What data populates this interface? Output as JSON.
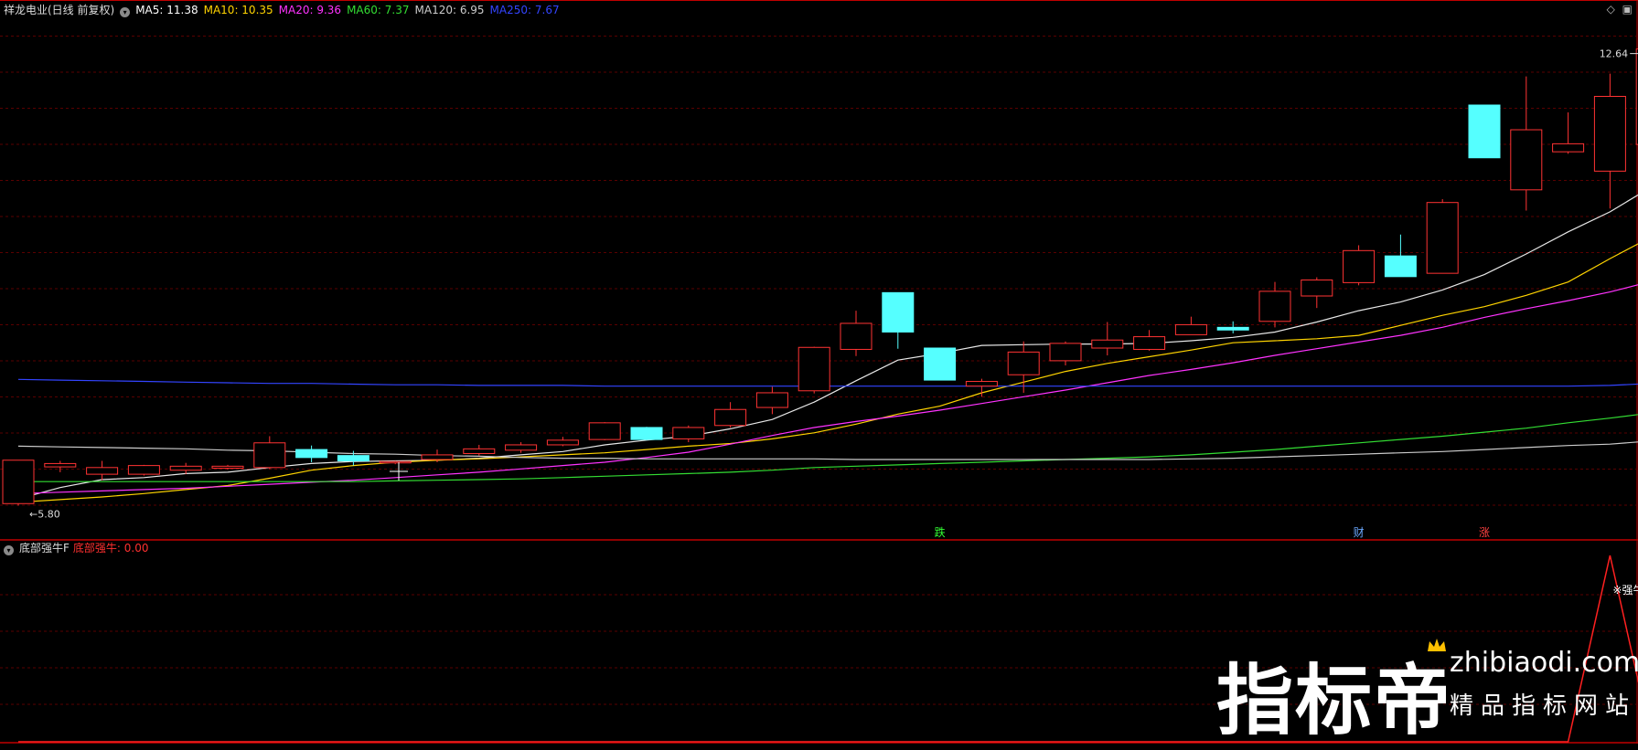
{
  "header": {
    "stock_title": "祥龙电业(日线 前复权)",
    "ma": [
      {
        "label": "MA5: 11.38",
        "color": "#ffffff"
      },
      {
        "label": "MA10: 10.35",
        "color": "#ffd400"
      },
      {
        "label": "MA20: 9.36",
        "color": "#ff33ff"
      },
      {
        "label": "MA60: 7.37",
        "color": "#33dd33"
      },
      {
        "label": "MA120: 6.95",
        "color": "#cccccc"
      },
      {
        "label": "MA250: 7.67",
        "color": "#3344ff"
      }
    ],
    "right_icons": [
      "diamond-icon",
      "square-icon"
    ]
  },
  "lower_header": {
    "indicator_name": "底部强牛F",
    "value_label": "底部强牛: 0.00",
    "value_color": "#ff3030"
  },
  "chart_data": {
    "type": "candlestick",
    "price_range": [
      5.3,
      13.1
    ],
    "max_label": "12.64",
    "min_label": "5.80",
    "up_color": "#ff3333",
    "down_color": "#55ffff",
    "candles": [
      {
        "o": 5.83,
        "h": 6.48,
        "l": 5.8,
        "c": 6.48
      },
      {
        "o": 6.38,
        "h": 6.47,
        "l": 6.3,
        "c": 6.43
      },
      {
        "o": 6.27,
        "h": 6.47,
        "l": 6.18,
        "c": 6.37
      },
      {
        "o": 6.27,
        "h": 6.41,
        "l": 6.25,
        "c": 6.4
      },
      {
        "o": 6.33,
        "h": 6.44,
        "l": 6.27,
        "c": 6.39
      },
      {
        "o": 6.36,
        "h": 6.41,
        "l": 6.34,
        "c": 6.39
      },
      {
        "o": 6.37,
        "h": 6.84,
        "l": 6.35,
        "c": 6.74
      },
      {
        "o": 6.64,
        "h": 6.7,
        "l": 6.45,
        "c": 6.52
      },
      {
        "o": 6.55,
        "h": 6.62,
        "l": 6.4,
        "c": 6.47
      },
      {
        "o": 6.46,
        "h": 6.47,
        "l": 6.42,
        "c": 6.46
      },
      {
        "o": 6.49,
        "h": 6.64,
        "l": 6.45,
        "c": 6.56
      },
      {
        "o": 6.58,
        "h": 6.71,
        "l": 6.55,
        "c": 6.65
      },
      {
        "o": 6.63,
        "h": 6.75,
        "l": 6.59,
        "c": 6.71
      },
      {
        "o": 6.71,
        "h": 6.83,
        "l": 6.69,
        "c": 6.78
      },
      {
        "o": 6.79,
        "h": 7.05,
        "l": 6.78,
        "c": 7.04
      },
      {
        "o": 6.97,
        "h": 6.98,
        "l": 6.78,
        "c": 6.79
      },
      {
        "o": 6.8,
        "h": 7.0,
        "l": 6.75,
        "c": 6.97
      },
      {
        "o": 7.0,
        "h": 7.35,
        "l": 6.97,
        "c": 7.24
      },
      {
        "o": 7.27,
        "h": 7.58,
        "l": 7.17,
        "c": 7.49
      },
      {
        "o": 7.52,
        "h": 8.18,
        "l": 7.48,
        "c": 8.17
      },
      {
        "o": 8.14,
        "h": 8.72,
        "l": 8.04,
        "c": 8.53
      },
      {
        "o": 8.99,
        "h": 8.99,
        "l": 8.15,
        "c": 8.4
      },
      {
        "o": 8.16,
        "h": 8.16,
        "l": 7.68,
        "c": 7.68
      },
      {
        "o": 7.59,
        "h": 7.7,
        "l": 7.43,
        "c": 7.66
      },
      {
        "o": 7.76,
        "h": 8.26,
        "l": 7.49,
        "c": 8.1
      },
      {
        "o": 7.97,
        "h": 8.26,
        "l": 7.9,
        "c": 8.23
      },
      {
        "o": 8.16,
        "h": 8.55,
        "l": 8.05,
        "c": 8.28
      },
      {
        "o": 8.14,
        "h": 8.43,
        "l": 8.12,
        "c": 8.33
      },
      {
        "o": 8.36,
        "h": 8.63,
        "l": 8.36,
        "c": 8.51
      },
      {
        "o": 8.47,
        "h": 8.56,
        "l": 8.38,
        "c": 8.43
      },
      {
        "o": 8.56,
        "h": 9.15,
        "l": 8.47,
        "c": 9.01
      },
      {
        "o": 8.94,
        "h": 9.22,
        "l": 8.76,
        "c": 9.18
      },
      {
        "o": 9.14,
        "h": 9.7,
        "l": 9.1,
        "c": 9.62
      },
      {
        "o": 9.54,
        "h": 9.86,
        "l": 9.23,
        "c": 9.23
      },
      {
        "o": 9.28,
        "h": 10.39,
        "l": 9.28,
        "c": 10.34
      },
      {
        "o": 11.8,
        "h": 11.8,
        "l": 11.01,
        "c": 11.01
      },
      {
        "o": 10.53,
        "h": 12.23,
        "l": 10.22,
        "c": 11.43
      },
      {
        "o": 11.1,
        "h": 11.69,
        "l": 11.07,
        "c": 11.22
      },
      {
        "o": 10.81,
        "h": 12.27,
        "l": 10.25,
        "c": 11.93
      },
      {
        "o": 11.21,
        "h": 12.64,
        "l": 11.21,
        "c": 12.64
      }
    ],
    "ma_lines": [
      {
        "name": "MA5",
        "color": "#e8e8e8",
        "values": [
          5.9,
          6.07,
          6.19,
          6.22,
          6.28,
          6.3,
          6.37,
          6.43,
          6.46,
          6.47,
          6.48,
          6.51,
          6.56,
          6.61,
          6.71,
          6.78,
          6.84,
          6.95,
          7.09,
          7.35,
          7.67,
          7.98,
          8.08,
          8.2,
          8.21,
          8.22,
          8.22,
          8.23,
          8.27,
          8.32,
          8.4,
          8.55,
          8.72,
          8.85,
          9.03,
          9.26,
          9.57,
          9.9,
          10.2,
          10.58
        ]
      },
      {
        "name": "MA10",
        "color": "#ffd400",
        "values": [
          5.85,
          5.89,
          5.93,
          5.98,
          6.04,
          6.1,
          6.21,
          6.33,
          6.4,
          6.45,
          6.48,
          6.5,
          6.53,
          6.56,
          6.59,
          6.64,
          6.69,
          6.73,
          6.8,
          6.89,
          7.02,
          7.17,
          7.29,
          7.49,
          7.65,
          7.81,
          7.93,
          8.03,
          8.13,
          8.24,
          8.27,
          8.3,
          8.35,
          8.5,
          8.65,
          8.78,
          8.95,
          9.15,
          9.5,
          9.83
        ]
      },
      {
        "name": "MA20",
        "color": "#ff33ff",
        "values": [
          5.98,
          6.0,
          6.02,
          6.04,
          6.06,
          6.09,
          6.12,
          6.15,
          6.18,
          6.22,
          6.26,
          6.3,
          6.35,
          6.4,
          6.45,
          6.52,
          6.6,
          6.72,
          6.85,
          6.97,
          7.06,
          7.14,
          7.23,
          7.33,
          7.43,
          7.53,
          7.64,
          7.75,
          7.84,
          7.94,
          8.05,
          8.15,
          8.25,
          8.35,
          8.47,
          8.62,
          8.75,
          8.87,
          9.0,
          9.16
        ]
      },
      {
        "name": "MA60",
        "color": "#33dd33",
        "values": [
          6.16,
          6.16,
          6.16,
          6.16,
          6.16,
          6.16,
          6.16,
          6.16,
          6.16,
          6.17,
          6.18,
          6.19,
          6.2,
          6.22,
          6.24,
          6.26,
          6.28,
          6.3,
          6.33,
          6.37,
          6.39,
          6.41,
          6.43,
          6.45,
          6.47,
          6.49,
          6.51,
          6.53,
          6.56,
          6.6,
          6.64,
          6.69,
          6.74,
          6.79,
          6.84,
          6.9,
          6.96,
          7.04,
          7.11,
          7.19
        ]
      },
      {
        "name": "MA120",
        "color": "#cccccc",
        "values": [
          6.69,
          6.68,
          6.67,
          6.66,
          6.65,
          6.63,
          6.62,
          6.6,
          6.58,
          6.57,
          6.55,
          6.54,
          6.52,
          6.51,
          6.51,
          6.5,
          6.5,
          6.5,
          6.5,
          6.5,
          6.49,
          6.49,
          6.49,
          6.49,
          6.49,
          6.49,
          6.49,
          6.49,
          6.5,
          6.51,
          6.53,
          6.55,
          6.57,
          6.59,
          6.61,
          6.64,
          6.67,
          6.7,
          6.72,
          6.77
        ]
      },
      {
        "name": "MA250",
        "color": "#3344ff",
        "values": [
          7.69,
          7.68,
          7.67,
          7.66,
          7.65,
          7.64,
          7.63,
          7.63,
          7.62,
          7.61,
          7.61,
          7.6,
          7.6,
          7.6,
          7.59,
          7.59,
          7.59,
          7.59,
          7.59,
          7.59,
          7.59,
          7.59,
          7.59,
          7.59,
          7.59,
          7.59,
          7.59,
          7.59,
          7.59,
          7.59,
          7.59,
          7.59,
          7.59,
          7.59,
          7.59,
          7.59,
          7.59,
          7.59,
          7.6,
          7.63
        ]
      }
    ],
    "markers": [
      {
        "index": 22,
        "text": "跌",
        "color": "#33ff33"
      },
      {
        "index": 32,
        "text": "财",
        "color": "#6aa8ff"
      },
      {
        "index": 35,
        "text": "涨",
        "color": "#ff4040"
      }
    ],
    "signal": {
      "label": "※强牛信号",
      "values": [
        0,
        0,
        0,
        0,
        0,
        0,
        0,
        0,
        0,
        0,
        0,
        0,
        0,
        0,
        0,
        0,
        0,
        0,
        0,
        0,
        0,
        0,
        0,
        0,
        0,
        0,
        0,
        0,
        0,
        0,
        0,
        0,
        0,
        0,
        0,
        0,
        0,
        0,
        1,
        0
      ],
      "color": "#ff2020",
      "range": [
        0,
        1
      ]
    }
  },
  "watermark": {
    "logo_text": "指标帝",
    "domain": "zhibiaodi.com",
    "tagline": "精品指标网站"
  }
}
